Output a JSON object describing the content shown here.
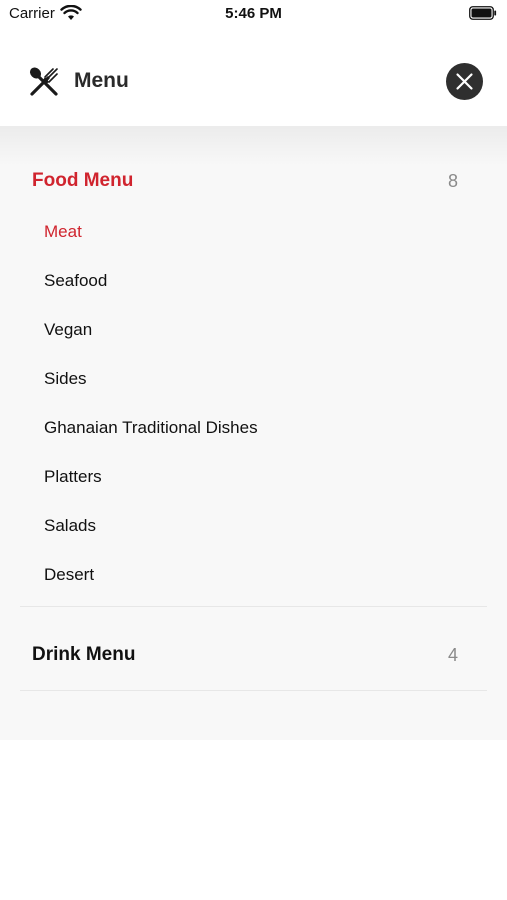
{
  "status_bar": {
    "carrier": "Carrier",
    "time": "5:46 PM",
    "wifi_icon": "wifi-icon",
    "battery_icon": "battery-icon"
  },
  "header": {
    "icon": "fork-spoon-icon",
    "title": "Menu",
    "close_icon": "close-icon"
  },
  "sections": [
    {
      "title": "Food Menu",
      "count": "8",
      "expanded": true,
      "items": [
        {
          "label": "Meat",
          "active": true
        },
        {
          "label": "Seafood",
          "active": false
        },
        {
          "label": "Vegan",
          "active": false
        },
        {
          "label": "Sides",
          "active": false
        },
        {
          "label": "Ghanaian Traditional Dishes",
          "active": false
        },
        {
          "label": "Platters",
          "active": false
        },
        {
          "label": "Salads",
          "active": false
        },
        {
          "label": "Desert",
          "active": false
        }
      ]
    },
    {
      "title": "Drink Menu",
      "count": "4",
      "expanded": false,
      "items": []
    }
  ],
  "colors": {
    "accent": "#d0242e",
    "panel_background": "#f8f8f8",
    "close_button": "#2f2f2f"
  }
}
